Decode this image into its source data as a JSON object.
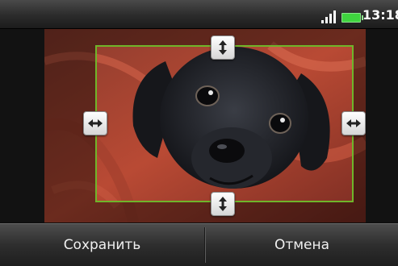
{
  "status_bar": {
    "time": "13:18",
    "signal_icon": "signal-bars-icon",
    "battery_icon": "battery-icon"
  },
  "editor": {
    "image_subject": "black-puppy-photo",
    "crop_handles": [
      "top",
      "bottom",
      "left",
      "right"
    ]
  },
  "actions": {
    "save_label": "Сохранить",
    "cancel_label": "Отмена"
  },
  "colors": {
    "crop_border": "#6fb52a",
    "battery": "#3fd33f"
  }
}
